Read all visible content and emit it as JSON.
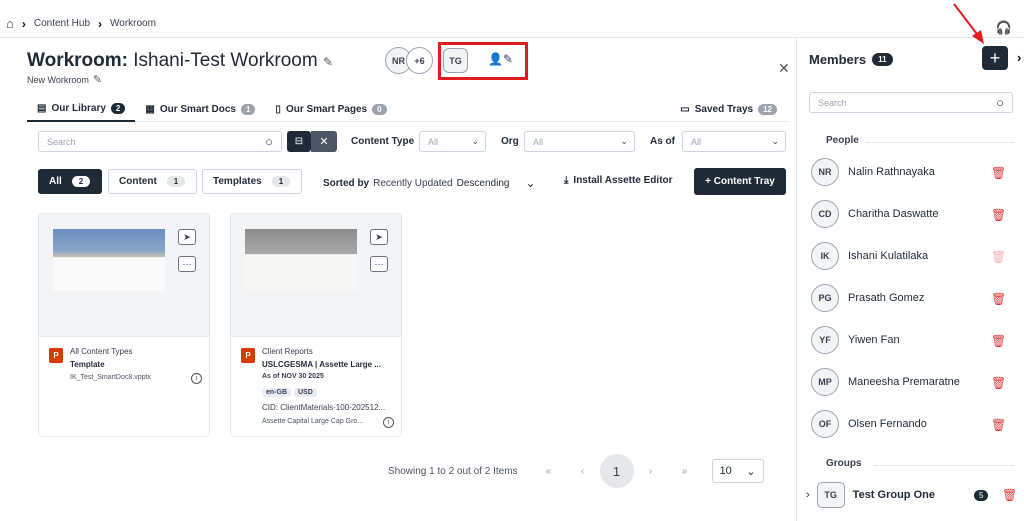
{
  "breadcrumb": {
    "items": [
      "Content Hub",
      "Workroom"
    ],
    "home_icon": "home-icon"
  },
  "header": {
    "title_bold": "Workroom:",
    "title_rest": " Ishani-Test Workroom",
    "subtitle": "New Workroom",
    "avatars": [
      "NR",
      "+6"
    ],
    "group_avatar": "TG"
  },
  "tabs": [
    {
      "label": "Our Library",
      "count": "2"
    },
    {
      "label": "Our Smart Docs",
      "count": "1"
    },
    {
      "label": "Our Smart Pages",
      "count": "0"
    },
    {
      "label": "Saved Trays",
      "count": "12"
    }
  ],
  "filters": {
    "search_placeholder": "Search",
    "content_type_label": "Content Type",
    "content_type_value": "All",
    "org_label": "Org",
    "org_value": "All",
    "as_of_label": "As of",
    "as_of_value": "All"
  },
  "segments": [
    {
      "label": "All",
      "count": "2"
    },
    {
      "label": "Content",
      "count": "1"
    },
    {
      "label": "Templates",
      "count": "1"
    }
  ],
  "sort": {
    "label": "Sorted by",
    "field": "Recently Updated",
    "order": "Descending"
  },
  "actions": {
    "install": "Install Assette Editor",
    "tray": "+ Content Tray"
  },
  "cards": [
    {
      "category": "All Content Types",
      "title": "Template",
      "file": "IK_Test_SmartDoc8.vpptx"
    },
    {
      "category": "Client Reports",
      "title": "USLCGESMA | Assette Large ...",
      "date": "As of NOV 30 2025",
      "tags": [
        "en-GB",
        "USD"
      ],
      "cid": "CID: ClientMaterials-100-202512...",
      "owner": "Assette Capital Large Cap Gro..."
    }
  ],
  "pager": {
    "summary": "Showing 1 to 2 out of 2 Items",
    "current": "1",
    "page_size": "10"
  },
  "members": {
    "title": "Members",
    "count": "11",
    "search_placeholder": "Search",
    "people_label": "People",
    "people": [
      {
        "initials": "NR",
        "name": "Nalin Rathnayaka"
      },
      {
        "initials": "CD",
        "name": "Charitha Daswatte"
      },
      {
        "initials": "IK",
        "name": "Ishani Kulatilaka"
      },
      {
        "initials": "PG",
        "name": "Prasath Gomez"
      },
      {
        "initials": "YF",
        "name": "Yiwen Fan"
      },
      {
        "initials": "MP",
        "name": "Maneesha Premaratne"
      },
      {
        "initials": "OF",
        "name": "Olsen Fernando"
      }
    ],
    "groups_label": "Groups",
    "group": {
      "initials": "TG",
      "name": "Test Group One",
      "count": "5"
    }
  },
  "colors": {
    "dark": "#1f2a37",
    "danger": "#e03a3a",
    "highlight": "#e11d21"
  }
}
